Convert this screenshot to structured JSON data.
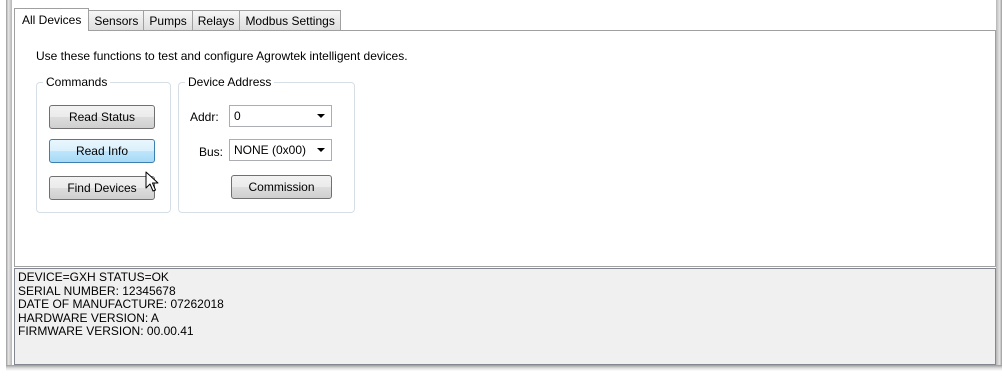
{
  "tabs": [
    {
      "label": "All Devices",
      "active": true
    },
    {
      "label": "Sensors",
      "active": false
    },
    {
      "label": "Pumps",
      "active": false
    },
    {
      "label": "Relays",
      "active": false
    },
    {
      "label": "Modbus Settings",
      "active": false
    }
  ],
  "description": "Use these functions to test and configure Agrowtek intelligent devices.",
  "commands": {
    "title": "Commands",
    "read_status": "Read Status",
    "read_info": "Read  Info",
    "find_devices": "Find Devices"
  },
  "device_address": {
    "title": "Device Address",
    "addr_label": "Addr:",
    "addr_value": "0",
    "bus_label": "Bus:",
    "bus_value": "NONE (0x00)",
    "commission": "Commission"
  },
  "output_lines": [
    "DEVICE=GXH STATUS=OK",
    "SERIAL NUMBER: 12345678",
    "DATE OF MANUFACTURE: 07262018",
    "HARDWARE VERSION: A",
    "FIRMWARE VERSION: 00.00.41"
  ],
  "icons": {
    "cursor": "mouse-pointer-icon",
    "dropdown": "chevron-down-icon"
  },
  "colors": {
    "hover_button": "#bee6fd",
    "output_background": "#f0f0f0"
  }
}
